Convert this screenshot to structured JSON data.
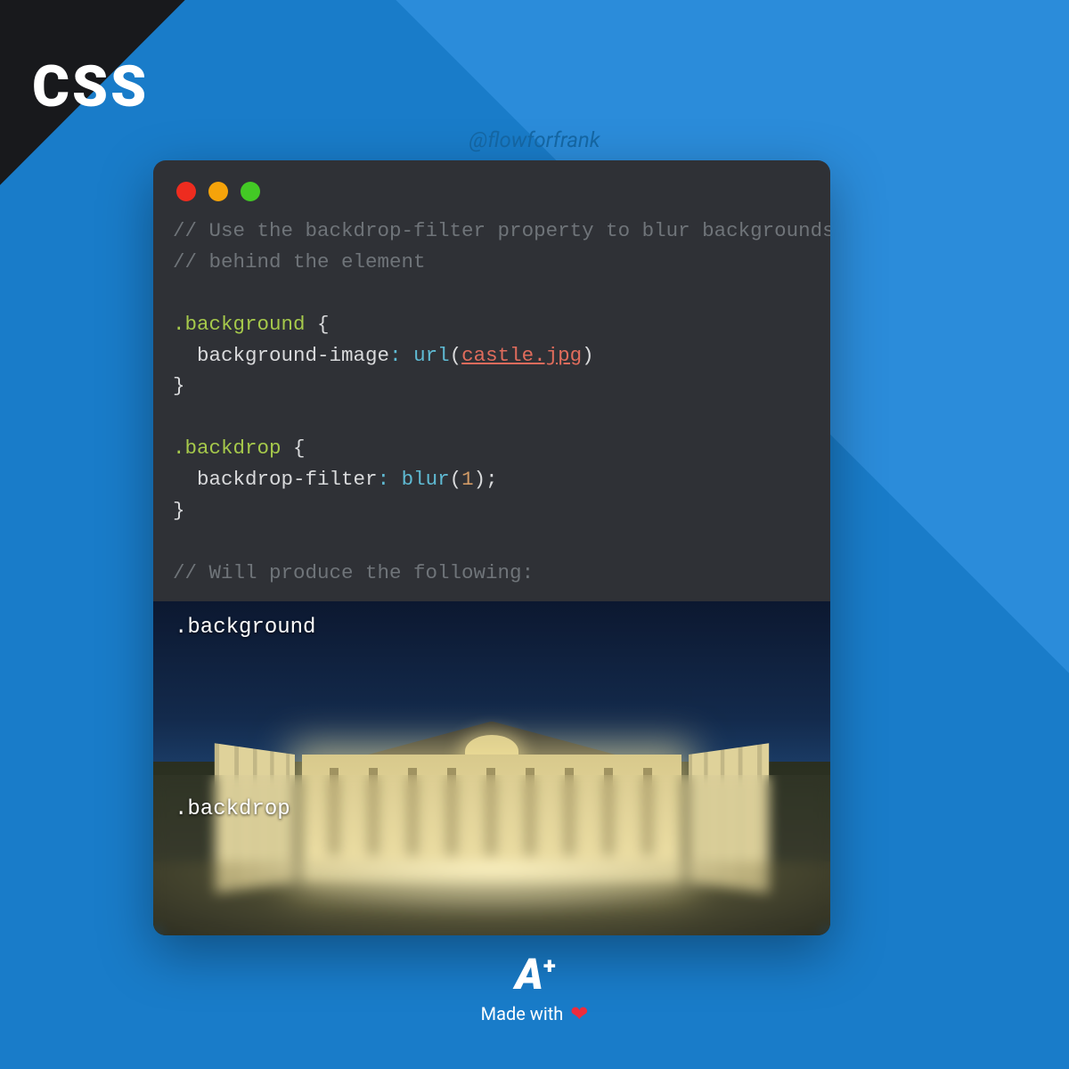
{
  "corner": {
    "label": "CSS"
  },
  "handle": "@flowforfrank",
  "code": {
    "comment1": "// Use the backdrop-filter property to blur backgrounds",
    "comment2": "// behind the element",
    "sel1": ".background",
    "prop1": "background-image",
    "fn1": "url",
    "url1": "castle.jpg",
    "sel2": ".backdrop",
    "prop2": "backdrop-filter",
    "fn2": "blur",
    "val2": "1",
    "comment3": "// Will produce the following:"
  },
  "demo": {
    "label_top": ".background",
    "label_bottom": ".backdrop"
  },
  "footer": {
    "logo_a": "A",
    "logo_plus": "+",
    "made": "Made with",
    "heart": "❤"
  }
}
